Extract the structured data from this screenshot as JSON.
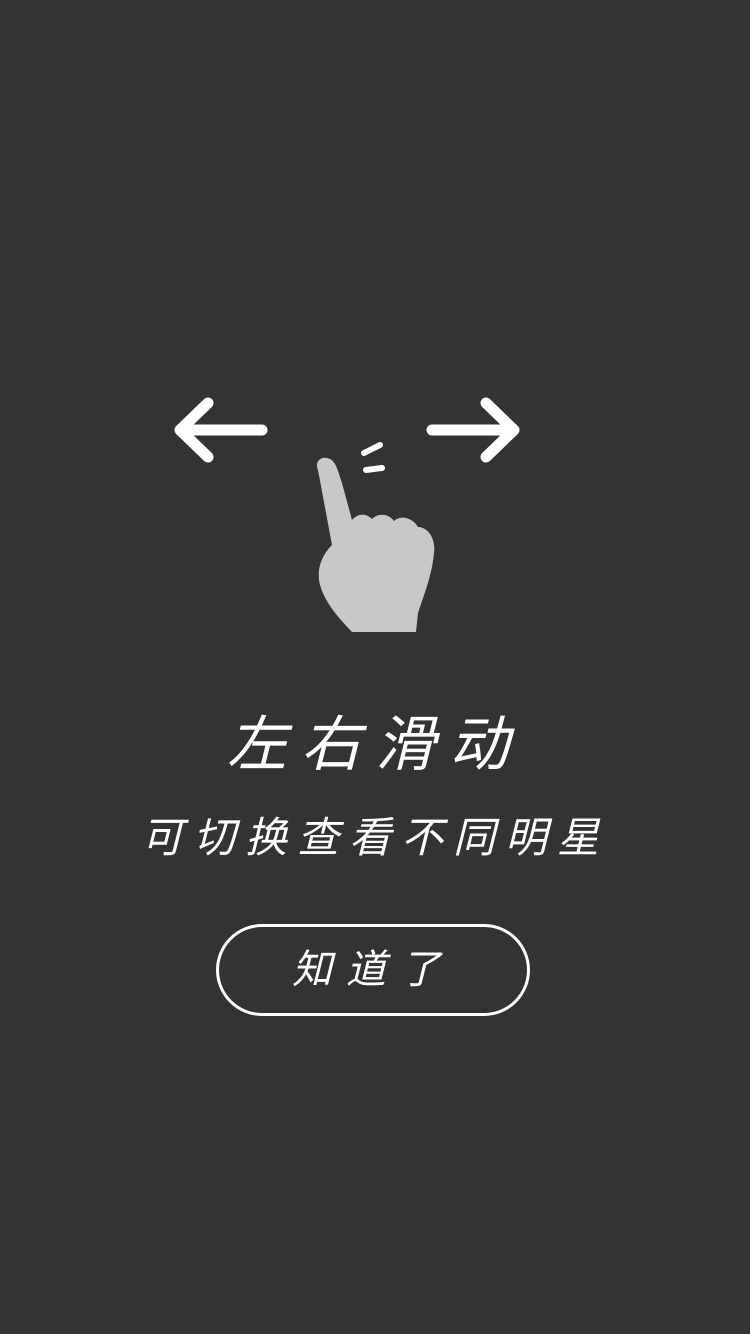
{
  "overlay": {
    "title": "左右滑动",
    "subtitle": "可切换查看不同明星",
    "confirm_label": "知道了"
  },
  "icons": {
    "left": "arrow-left-icon",
    "right": "arrow-right-icon",
    "hand": "swipe-hand-icon"
  },
  "colors": {
    "background": "#333333",
    "text": "#ffffff",
    "hand": "#c8c8c8"
  }
}
